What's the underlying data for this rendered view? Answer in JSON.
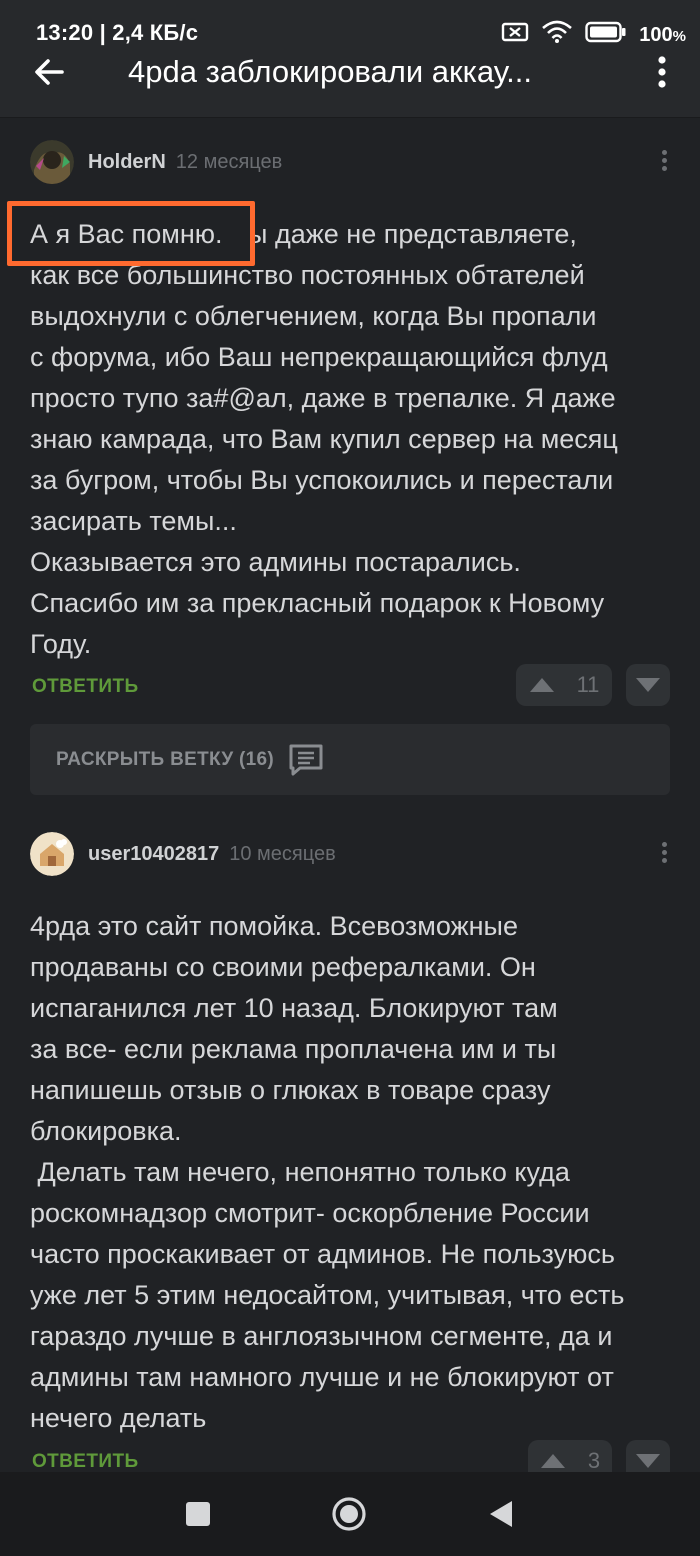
{
  "status": {
    "time": "13:20",
    "speed": "2,4 КБ/с",
    "battery": "100",
    "battery_unit": "%"
  },
  "appbar": {
    "title": "4pda заблокировали аккау..."
  },
  "comments": [
    {
      "author": "HolderN",
      "time": "12 месяцев",
      "highlight": "А я Вас помню.",
      "text": "А я Вас помню. Вы даже не представляете,\nкак все большинство постоянных обтателей\nвыдохнули с облегчением, когда Вы пропали\nс форума, ибо Ваш непрекращающийся флуд\nпросто тупо за#@ал, даже в трепалке. Я даже\nзнаю камрада, что Вам купил сервер на месяц\nза бугром, чтобы Вы успокоились и перестали\nзасирать темы...\nОказывается это админы постарались.\nСпасибо им за прекласный подарок к Новому\nГоду.",
      "reply": "ОТВЕТИТЬ",
      "votes": "11"
    },
    {
      "author": "user10402817",
      "time": "10 месяцев",
      "text": "4рда это сайт помойка. Всевозможные\nпродаваны со своими рефералками. Он\nиспаганился лет 10 назад. Блокируют там\nза все- если реклама проплачена им и ты\nнапишешь отзыв о глюках в товаре сразу\nблокировка.\n Делать там нечего, непонятно только куда\nроскомнадзор смотрит- оскорбление России\nчасто проскакивает от админов. Не пользуюсь\nуже лет 5 этим недосайтом, учитывая, что есть\nгараздо лучше в англоязычном сегменте, да и\nадмины там намного лучше и не блокируют от\nнечего делать",
      "reply": "ОТВЕТИТЬ",
      "votes": "3"
    }
  ],
  "thread": {
    "expand_label": "РАСКРЫТЬ ВЕТКУ (16)"
  },
  "colors": {
    "background": "#202225",
    "accent_green": "#5f9a3a",
    "highlight_orange": "#ff6a2f"
  }
}
